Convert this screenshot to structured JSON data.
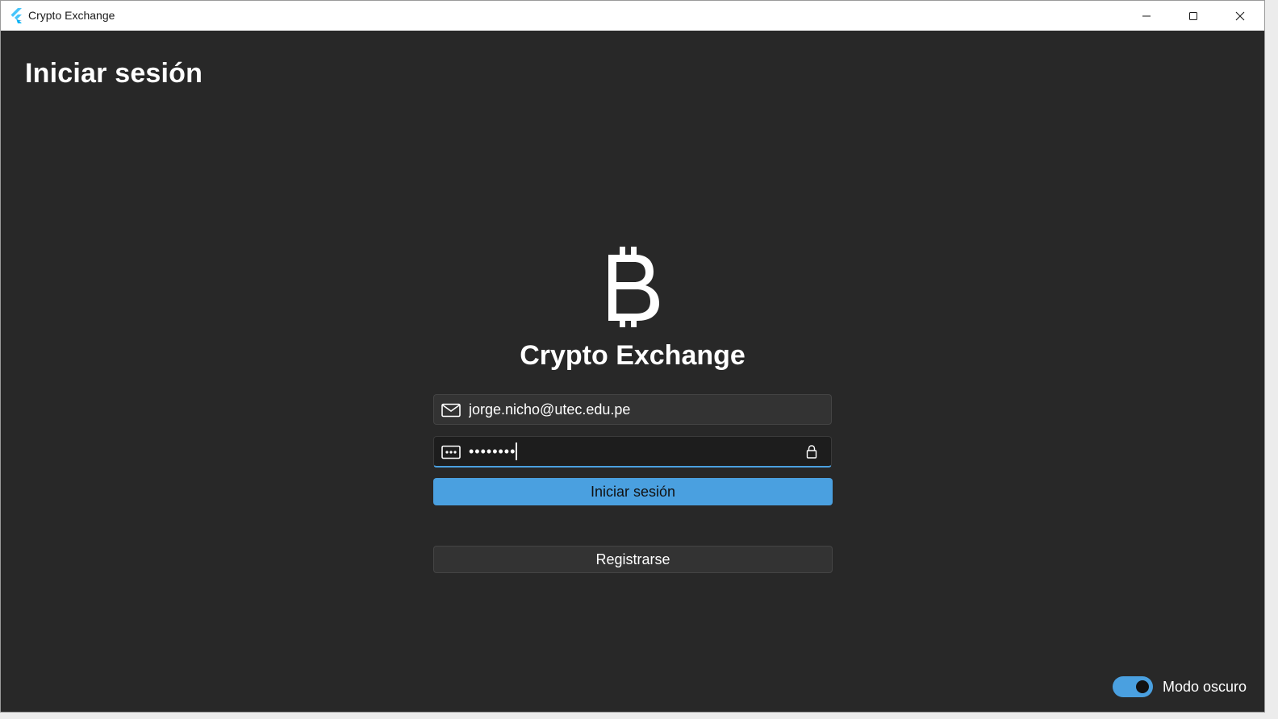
{
  "window": {
    "title": "Crypto Exchange",
    "controls": [
      "minimize-icon",
      "maximize-icon",
      "close-icon"
    ]
  },
  "header": {
    "title": "Iniciar sesión"
  },
  "brand": {
    "logo_icon": "bitcoin-icon",
    "name": "Crypto Exchange"
  },
  "form": {
    "email": {
      "icon": "mail-icon",
      "value": "jorge.nicho@utec.edu.pe"
    },
    "password": {
      "icon": "password-icon",
      "value": "••••••••",
      "trailing_icon": "lock-icon"
    },
    "login_label": "Iniciar sesión",
    "register_label": "Registrarse"
  },
  "theme_toggle": {
    "label": "Modo oscuro",
    "on": true
  },
  "colors": {
    "background": "#282828",
    "accent": "#4aa0e0",
    "field": "#333333",
    "text": "#ffffff"
  }
}
